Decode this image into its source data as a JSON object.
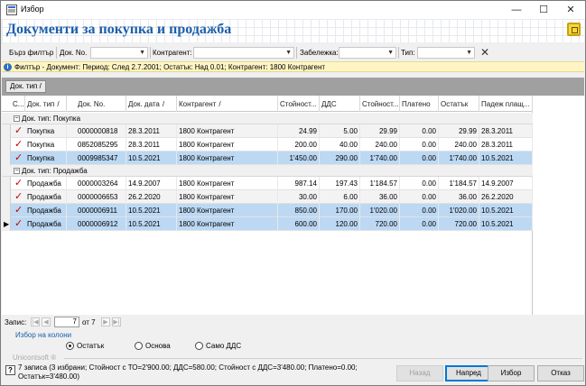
{
  "window": {
    "title": "Избор"
  },
  "header": {
    "title": "Документи за покупка и продажба"
  },
  "filter_toolbar": {
    "quick_filter": "Бърз филтър",
    "doc_no_label": "Док. No.",
    "counterparty_label": "Контрагент:",
    "note_label": "Забележка:",
    "type_label": "Тип:"
  },
  "filter_bar": {
    "text": "Филтър - Документ: Период: След 2.7.2001; Остатък: Над 0.01; Контрагент: 1800 Контрагент"
  },
  "group_chip": {
    "label": "Док. тип",
    "sort": "/"
  },
  "columns": [
    "С...",
    "Док. тип",
    "Док. No.",
    "Док. дата",
    "Контрагент",
    "Стойност...",
    "ДДС",
    "Стойност...",
    "Платено",
    "Остатък",
    "Падеж плащ..."
  ],
  "column_sort": {
    "doc_type": "/",
    "doc_date": "/",
    "counterparty": "/"
  },
  "groups": [
    {
      "label": "Док. тип: Покупка",
      "rows": [
        {
          "type": "Покупка",
          "no": "0000000818",
          "date": "28.3.2011",
          "party": "1800 Контрагент",
          "value": "24.99",
          "vat": "5.00",
          "total": "29.99",
          "paid": "0.00",
          "rest": "29.99",
          "due": "28.3.2011"
        },
        {
          "type": "Покупка",
          "no": "0852085295",
          "date": "28.3.2011",
          "party": "1800 Контрагент",
          "value": "200.00",
          "vat": "40.00",
          "total": "240.00",
          "paid": "0.00",
          "rest": "240.00",
          "due": "28.3.2011"
        },
        {
          "type": "Покупка",
          "no": "0009985347",
          "date": "10.5.2021",
          "party": "1800 Контрагент",
          "value": "1'450.00",
          "vat": "290.00",
          "total": "1'740.00",
          "paid": "0.00",
          "rest": "1'740.00",
          "due": "10.5.2021"
        }
      ]
    },
    {
      "label": "Док. тип: Продажба",
      "rows": [
        {
          "type": "Продажба",
          "no": "0000003264",
          "date": "14.9.2007",
          "party": "1800 Контрагент",
          "value": "987.14",
          "vat": "197.43",
          "total": "1'184.57",
          "paid": "0.00",
          "rest": "1'184.57",
          "due": "14.9.2007"
        },
        {
          "type": "Продажба",
          "no": "0000006653",
          "date": "26.2.2020",
          "party": "1800 Контрагент",
          "value": "30.00",
          "vat": "6.00",
          "total": "36.00",
          "paid": "0.00",
          "rest": "36.00",
          "due": "26.2.2020"
        },
        {
          "type": "Продажба",
          "no": "0000006911",
          "date": "10.5.2021",
          "party": "1800 Контрагент",
          "value": "850.00",
          "vat": "170.00",
          "total": "1'020.00",
          "paid": "0.00",
          "rest": "1'020.00",
          "due": "10.5.2021"
        },
        {
          "type": "Продажба",
          "no": "0000006912",
          "date": "10.5.2021",
          "party": "1800 Контрагент",
          "value": "600.00",
          "vat": "120.00",
          "total": "720.00",
          "paid": "0.00",
          "rest": "720.00",
          "due": "10.5.2021"
        }
      ]
    }
  ],
  "selection_states": {
    "g0": [
      "alt",
      "",
      "sel"
    ],
    "g1": [
      "",
      "alt",
      "sel",
      "sel"
    ]
  },
  "navigator": {
    "label": "Запис:",
    "current": "7",
    "of_text": "от 7"
  },
  "column_chooser": "Избор на колони",
  "radio_options": [
    {
      "label": "Остатък",
      "checked": true
    },
    {
      "label": "Основа",
      "checked": false
    },
    {
      "label": "Само ДДС",
      "checked": false
    }
  ],
  "brand": "Unicontsoft ®",
  "status_text": "7 записа (3 избрани; Стойност с ТО=2'900.00; ДДС=580.00; Стойност с ДДС=3'480.00; Платено=0.00; Остатък=3'480.00)",
  "buttons": {
    "back": "Назад",
    "next": "Напред",
    "select": "Избор",
    "cancel": "Отказ"
  }
}
